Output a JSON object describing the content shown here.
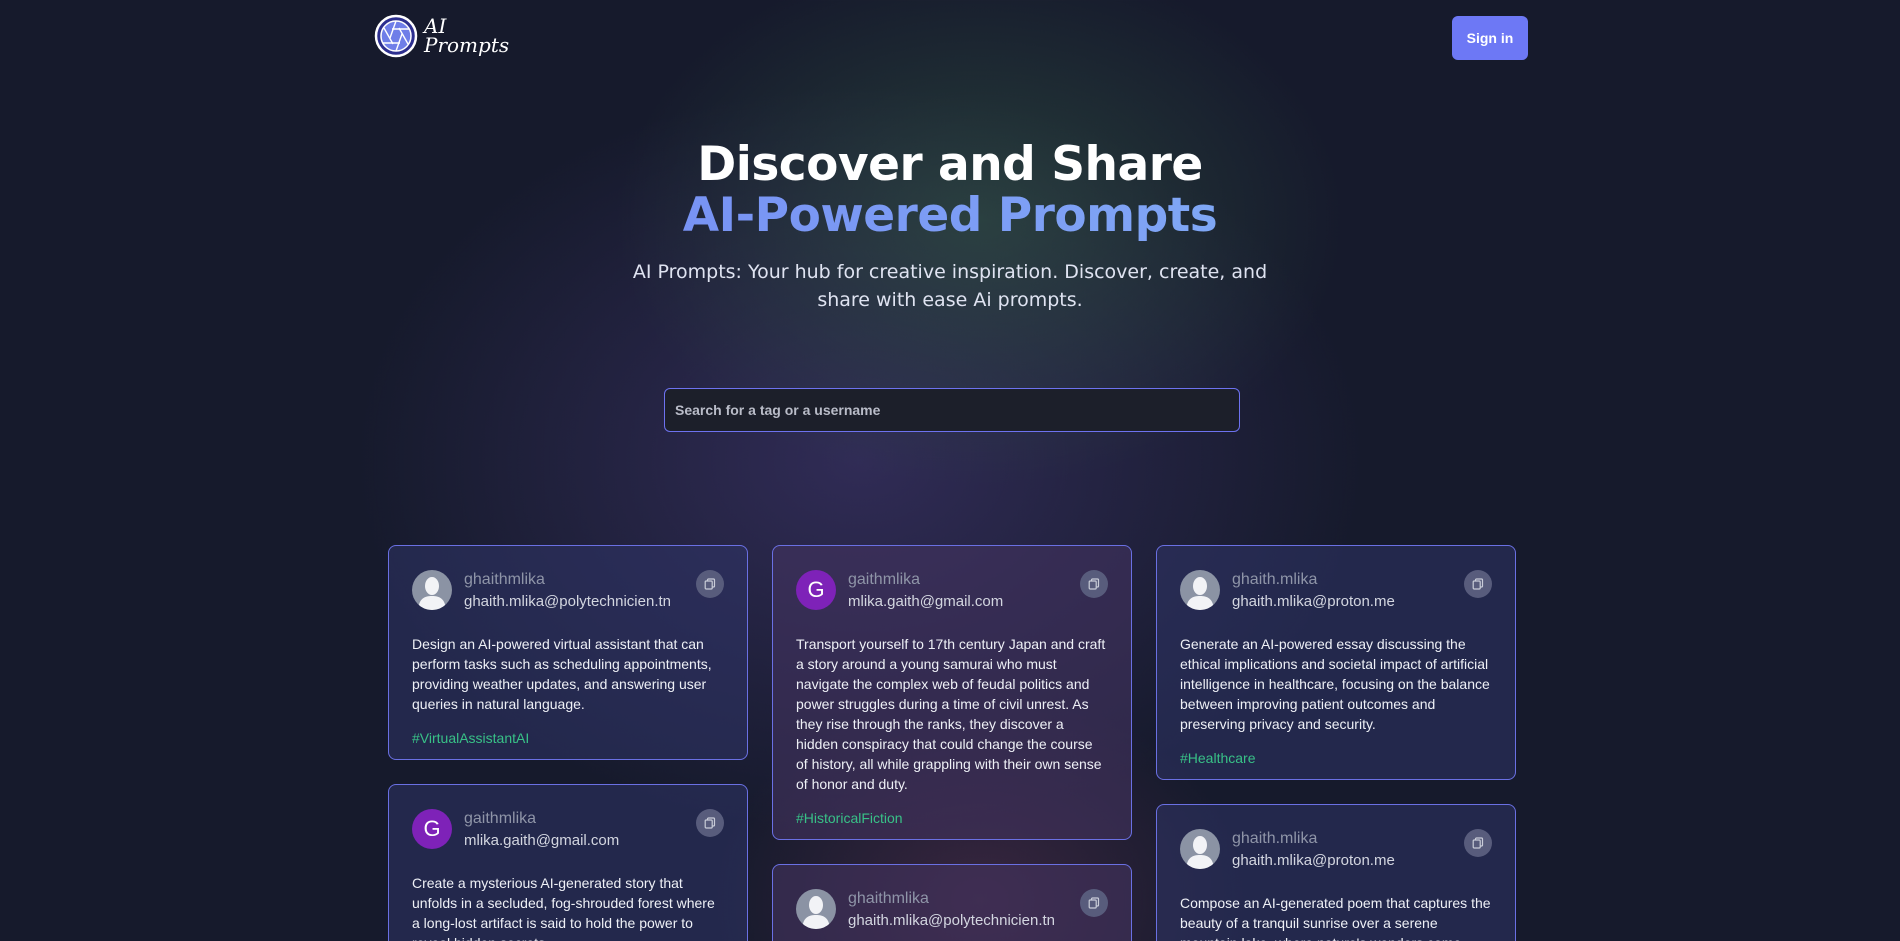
{
  "nav": {
    "logo_line1": "AI",
    "logo_line2": "Prompts",
    "signin_label": "Sign in"
  },
  "hero": {
    "title_line1": "Discover and Share",
    "title_line2": "AI-Powered Prompts",
    "subtitle": "AI Prompts: Your hub for creative inspiration. Discover, create, and share with ease Ai prompts."
  },
  "search": {
    "placeholder": "Search for a tag or a username",
    "value": ""
  },
  "colors": {
    "accent": "#6d78f5",
    "tag": "#38c187",
    "letter_avatar": "#7e22b8"
  },
  "cards": [
    {
      "username": "ghaithmlika",
      "email": "ghaith.mlika@polytechnicien.tn",
      "avatar": "user-silhouette-icon",
      "prompt": "Design an AI-powered virtual assistant that can perform tasks such as scheduling appointments, providing weather updates, and answering user queries in natural language.",
      "tag": "#VirtualAssistantAI"
    },
    {
      "username": "gaithmlika",
      "email": "mlika.gaith@gmail.com",
      "avatar": "G",
      "prompt": "Create a mysterious AI-generated story that unfolds in a secluded, fog-shrouded forest where a long-lost artifact is said to hold the power to reveal hidden secrets.",
      "tag": ""
    },
    {
      "username": "gaithmlika",
      "email": "mlika.gaith@gmail.com",
      "avatar": "G",
      "prompt": "Transport yourself to 17th century Japan and craft a story around a young samurai who must navigate the complex web of feudal politics and power struggles during a time of civil unrest. As they rise through the ranks, they discover a hidden conspiracy that could change the course of history, all while grappling with their own sense of honor and duty.",
      "tag": "#HistoricalFiction"
    },
    {
      "username": "ghaithmlika",
      "email": "ghaith.mlika@polytechnicien.tn",
      "avatar": "user-silhouette-icon",
      "prompt": "",
      "tag": ""
    },
    {
      "username": "ghaith.mlika",
      "email": "ghaith.mlika@proton.me",
      "avatar": "user-silhouette-icon",
      "prompt": "Generate an AI-powered essay discussing the ethical implications and societal impact of artificial intelligence in healthcare, focusing on the balance between improving patient outcomes and preserving privacy and security.",
      "tag": "#Healthcare"
    },
    {
      "username": "ghaith.mlika",
      "email": "ghaith.mlika@proton.me",
      "avatar": "user-silhouette-icon",
      "prompt": "Compose an AI-generated poem that captures the beauty of a tranquil sunrise over a serene mountain lake, where nature's wonders come alive.",
      "tag": ""
    }
  ]
}
